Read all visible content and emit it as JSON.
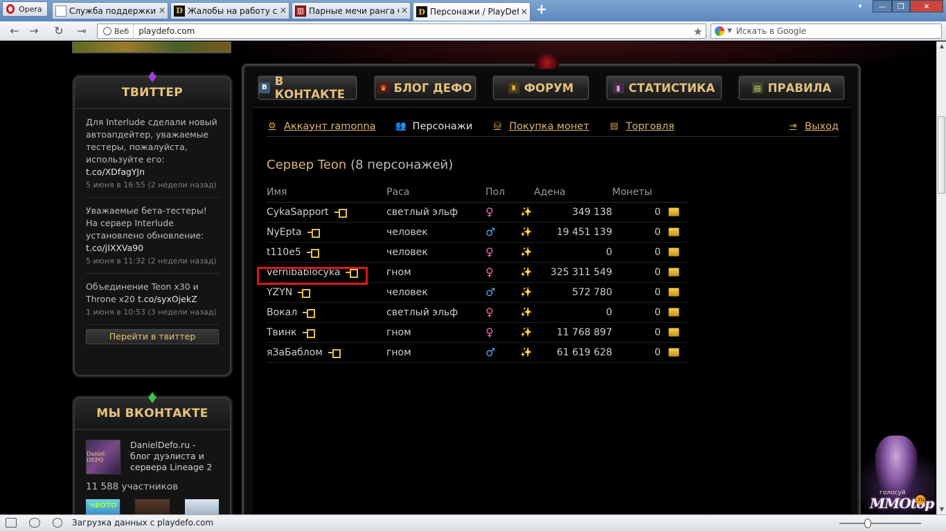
{
  "browser": {
    "menu_label": "Opera",
    "tabs": [
      {
        "title": "Служба поддержки п...",
        "favicon": "doc-icon"
      },
      {
        "title": "Жалобы на работу сл...",
        "favicon": "d-icon"
      },
      {
        "title": "Парные мечи ранга С...",
        "favicon": "forum-icon"
      },
      {
        "title": "Персонажи / PlayDefo",
        "favicon": "d-icon",
        "active": true
      }
    ],
    "address": {
      "scheme_label": "Веб",
      "url": "playdefo.com"
    },
    "search": {
      "placeholder": "Искать в Google"
    },
    "status_text": "Загрузка данных с playdefo.com"
  },
  "sidebar": {
    "twitter": {
      "title": "ТВИТТЕР",
      "tweets": [
        {
          "text": "Для Interlude сделали новый автоапдейтер, уважаемые тестеры, пожалуйста, используйте его: ",
          "link": "t.co/XDfagYJn",
          "date": "5 июня в 16:55 (2 недели назад)"
        },
        {
          "text": "Уважаемые бета-тестеры! На сервер Interlude установлено обновление: ",
          "link": "t.co/jIXXVa90",
          "date": "5 июня в 11:32 (2 недели назад)"
        },
        {
          "text": "Объединение Teon x30 и Throne x20 ",
          "link": "t.co/syxOjekZ",
          "date": "1 июня в 10:53 (3 недели назад)"
        }
      ],
      "button": "Перейти в твиттер"
    },
    "vk": {
      "title": "МЫ ВКОНТАКТЕ",
      "group_image_text": "Daniel DEFO",
      "group_name": "DanielDefo.ru - блог дуэлиста и сервера Lineage 2",
      "members": "11 588 участников",
      "thumb_text": "ЧВОТО"
    }
  },
  "menu": [
    {
      "label": "В КОНТАКТЕ",
      "icon": "vk-icon",
      "glyph": "В"
    },
    {
      "label": "БЛОГ ДЕФО",
      "icon": "crown-icon",
      "glyph": "♛"
    },
    {
      "label": "ФОРУМ",
      "icon": "tower-icon",
      "glyph": "♜"
    },
    {
      "label": "СТАТИСТИКА",
      "icon": "stats-icon",
      "glyph": "▮"
    },
    {
      "label": "ПРАВИЛА",
      "icon": "rules-icon",
      "glyph": "▤"
    }
  ],
  "subnav": {
    "account": "Аккаунт ramonna",
    "characters": "Персонажи",
    "buy_coins": "Покупка монет",
    "trade": "Торговля",
    "logout": "Выход"
  },
  "server": {
    "name": "Сервер Teon",
    "count": "(8 персонажей)"
  },
  "table": {
    "headers": {
      "name": "Имя",
      "race": "Раса",
      "sex": "Пол",
      "adena": "Адена",
      "coins": "Монеты"
    },
    "rows": [
      {
        "name": "CykaSapport",
        "race": "светлый эльф",
        "sex": "female",
        "adena": "349 138",
        "coins": "0"
      },
      {
        "name": "NyEpta",
        "race": "человек",
        "sex": "male",
        "adena": "19 451 139",
        "coins": "0"
      },
      {
        "name": "t110e5",
        "race": "человек",
        "sex": "female",
        "adena": "0",
        "coins": "0"
      },
      {
        "name": "vernibablocyka",
        "race": "гном",
        "sex": "female",
        "adena": "325 311 549",
        "coins": "0"
      },
      {
        "name": "YZYN",
        "race": "человек",
        "sex": "male",
        "adena": "572 780",
        "coins": "0"
      },
      {
        "name": "Вокал",
        "race": "светлый эльф",
        "sex": "female",
        "adena": "0",
        "coins": "0"
      },
      {
        "name": "Твинк",
        "race": "гном",
        "sex": "female",
        "adena": "11 768 897",
        "coins": "0"
      },
      {
        "name": "яЗаБаблом",
        "race": "гном",
        "sex": "male",
        "adena": "61 619 628",
        "coins": "0"
      }
    ]
  },
  "mmotop": {
    "label": "MMOtop",
    "vote": "голосуй",
    "badge": ".ru"
  },
  "colors": {
    "accent_gold": "#e4c07a",
    "highlight_red": "#e01616",
    "female": "#e66fb0",
    "male": "#4fa6e8"
  }
}
